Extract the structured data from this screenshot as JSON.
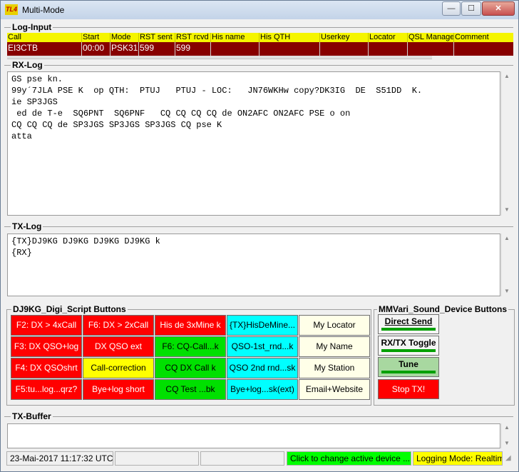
{
  "window": {
    "title": "Multi-Mode",
    "app_icon_text": "TL4",
    "btn_minimize": "—",
    "btn_maximize": "☐",
    "btn_close": "✕"
  },
  "log_input": {
    "title": "Log-Input",
    "headers": [
      "Call",
      "Start",
      "Mode",
      "RST sent",
      "RST rcvd",
      "His name",
      "His QTH",
      "Userkey",
      "Locator",
      "QSL Manager",
      "Comment"
    ],
    "values": [
      "EI3CTB",
      "00:00",
      "PSK31",
      "599",
      "599",
      "",
      "",
      "",
      "",
      "",
      ""
    ]
  },
  "rx_log": {
    "title": "RX-Log",
    "text": "GS pse kn.\n99y´7JLA PSE K  op QTH:  PTUJ   PTUJ - LOC:   JN76WKHw copy?DK3IG  DE  S51DD  K.\nie SP3JGS\n ed de T-e  SQ6PNT  SQ6PNF   CQ CQ CQ CQ de ON2AFC ON2AFC PSE o on\nCQ CQ CQ de SP3JGS SP3JGS SP3JGS CQ pse K\natta"
  },
  "tx_log": {
    "title": "TX-Log",
    "text": "{TX}DJ9KG DJ9KG DJ9KG DJ9KG k\n{RX}"
  },
  "macros": {
    "title": "DJ9KG_Digi_Script Buttons",
    "buttons": [
      {
        "label": "F2: DX > 4xCall",
        "color": "red"
      },
      {
        "label": "F6: DX > 2xCall",
        "color": "red"
      },
      {
        "label": "His de 3xMine k",
        "color": "red"
      },
      {
        "label": "{TX}HisDeMine...",
        "color": "cyan"
      },
      {
        "label": "My Locator",
        "color": "cream"
      },
      {
        "label": "F3: DX QSO+log",
        "color": "red"
      },
      {
        "label": "DX QSO ext",
        "color": "red"
      },
      {
        "label": "F6: CQ-Call...k",
        "color": "green"
      },
      {
        "label": "QSO-1st_rnd...k",
        "color": "cyan"
      },
      {
        "label": "My Name",
        "color": "cream"
      },
      {
        "label": "F4: DX QSOshrt",
        "color": "red"
      },
      {
        "label": "Call-correction",
        "color": "yellow"
      },
      {
        "label": "CQ DX Call k",
        "color": "green"
      },
      {
        "label": "QSO 2nd rnd...sk",
        "color": "cyan"
      },
      {
        "label": "My Station",
        "color": "cream"
      },
      {
        "label": "F5:tu...log...qrz?",
        "color": "red"
      },
      {
        "label": "Bye+log short",
        "color": "red"
      },
      {
        "label": "CQ Test ...bk",
        "color": "green"
      },
      {
        "label": "Bye+log...sk(ext)",
        "color": "cyan"
      },
      {
        "label": "Email+Website",
        "color": "cream"
      }
    ]
  },
  "mmvari": {
    "title": "MMVari_Sound_Device Buttons",
    "direct_send": "Direct Send",
    "rx_tx_toggle": "RX/TX Toggle",
    "tune": "Tune",
    "stop_tx": "Stop TX!",
    "colors": {
      "indicator": "#00a000",
      "tune_bg": "#a8d8a0",
      "stop_bg": "#ff0000"
    }
  },
  "tx_buffer": {
    "title": "TX-Buffer",
    "text": ""
  },
  "status": {
    "datetime": "23-Mai-2017  11:17:32 UTC",
    "device": "Click to change active device ...",
    "logging_mode": "Logging Mode: Realtime"
  }
}
